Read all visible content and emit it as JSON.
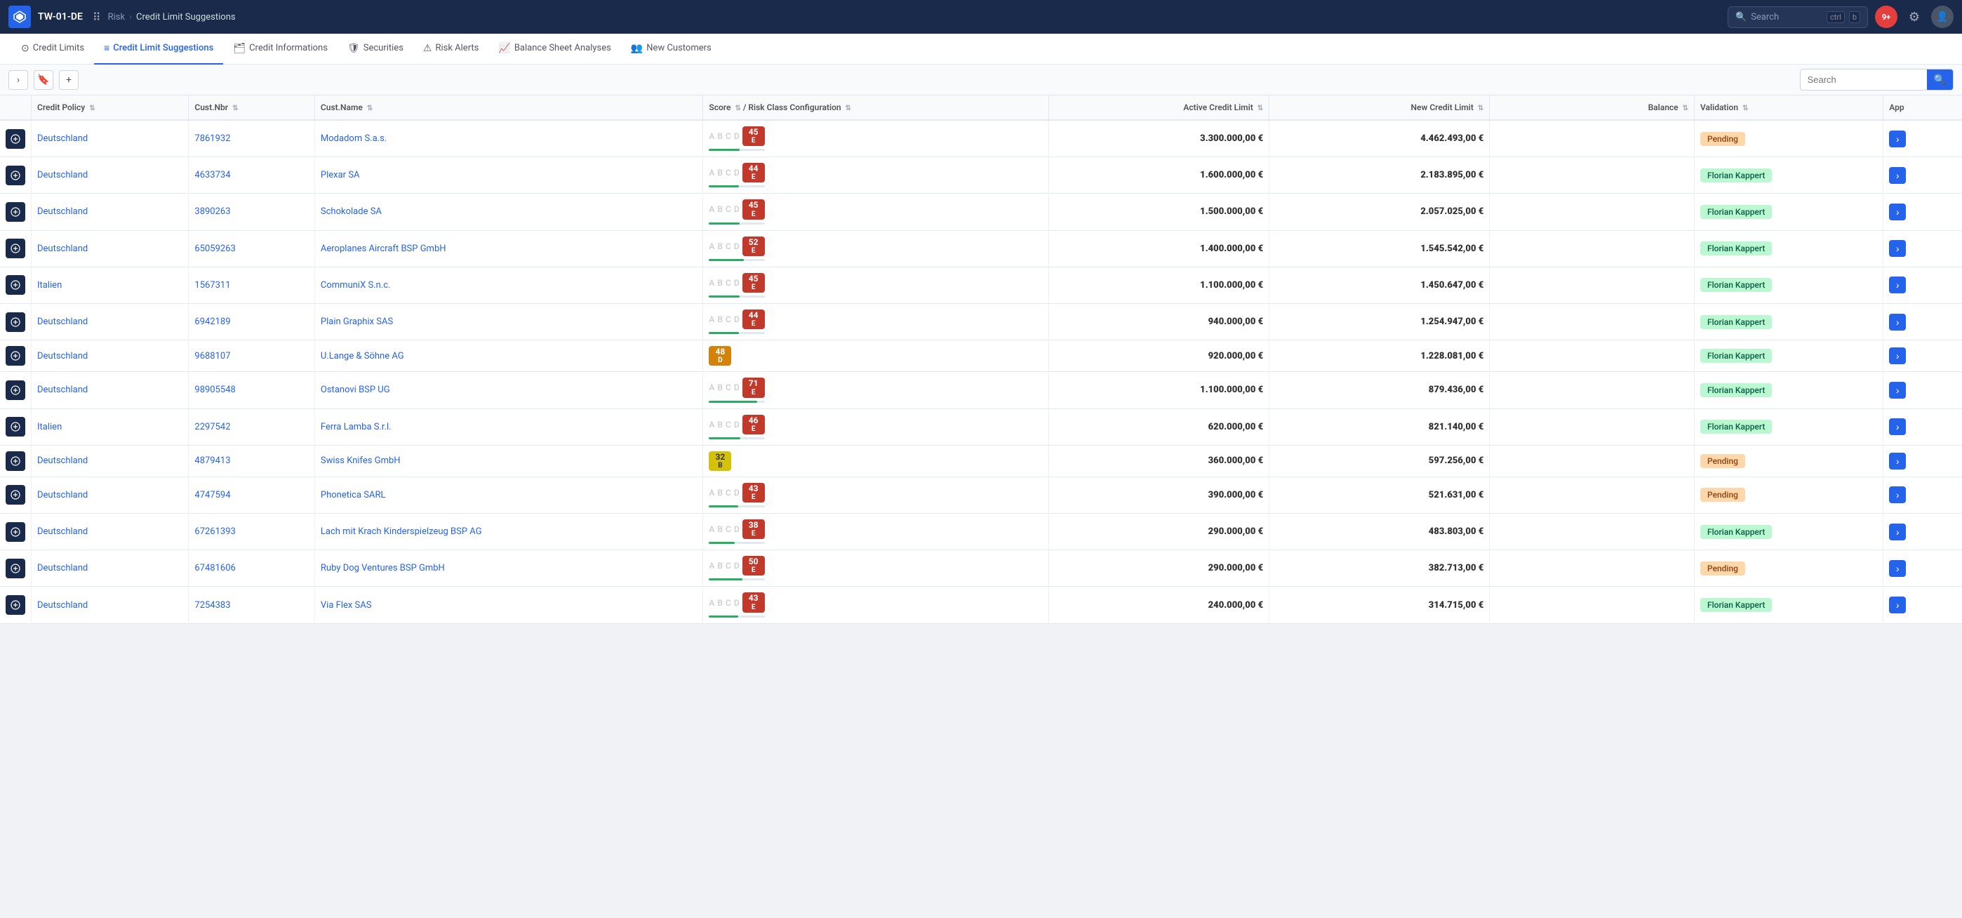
{
  "topbar": {
    "appcode": "TW-01-DE",
    "breadcrumb_root": "Risk",
    "breadcrumb_current": "Credit Limit Suggestions",
    "search_placeholder": "Search",
    "search_shortcut": "ctrl b",
    "notif_count": "9+"
  },
  "nav": {
    "items": [
      {
        "id": "credit-limits",
        "label": "Credit Limits",
        "icon": "⊙",
        "active": false
      },
      {
        "id": "credit-limit-suggestions",
        "label": "Credit Limit Suggestions",
        "icon": "≡",
        "active": true
      },
      {
        "id": "credit-informations",
        "label": "Credit Informations",
        "icon": "🗂",
        "active": false
      },
      {
        "id": "securities",
        "label": "Securities",
        "icon": "🛡",
        "active": false
      },
      {
        "id": "risk-alerts",
        "label": "Risk Alerts",
        "icon": "⚠",
        "active": false
      },
      {
        "id": "balance-sheet-analyses",
        "label": "Balance Sheet Analyses",
        "icon": "📈",
        "active": false
      },
      {
        "id": "new-customers",
        "label": "New Customers",
        "icon": "👥",
        "active": false
      }
    ]
  },
  "toolbar": {
    "search_placeholder": "Search"
  },
  "table": {
    "columns": [
      {
        "id": "icon",
        "label": ""
      },
      {
        "id": "credit-policy",
        "label": "Credit Policy"
      },
      {
        "id": "cust-nbr",
        "label": "Cust.Nbr"
      },
      {
        "id": "cust-name",
        "label": "Cust.Name"
      },
      {
        "id": "score",
        "label": "Score / Risk Class Configuration"
      },
      {
        "id": "active-credit-limit",
        "label": "Active Credit Limit"
      },
      {
        "id": "new-credit-limit",
        "label": "New Credit Limit"
      },
      {
        "id": "balance",
        "label": "Balance"
      },
      {
        "id": "validation",
        "label": "Validation"
      },
      {
        "id": "app",
        "label": "App"
      }
    ],
    "rows": [
      {
        "policy": "Deutschland",
        "cust_nbr": "7861932",
        "cust_name": "Modadom S.a.s.",
        "score": 45,
        "score_letter": "E",
        "badge_class": "badge-e",
        "has_abcd": true,
        "active_credit_limit": "3.300.000,00 €",
        "new_credit_limit": "4.462.493,00 €",
        "balance": "",
        "validation": "Pending",
        "validation_class": "status-pending"
      },
      {
        "policy": "Deutschland",
        "cust_nbr": "4633734",
        "cust_name": "Plexar SA",
        "score": 44,
        "score_letter": "E",
        "badge_class": "badge-e",
        "has_abcd": true,
        "active_credit_limit": "1.600.000,00 €",
        "new_credit_limit": "2.183.895,00 €",
        "balance": "",
        "validation": "Florian Kappert",
        "validation_class": "status-florian"
      },
      {
        "policy": "Deutschland",
        "cust_nbr": "3890263",
        "cust_name": "Schokolade SA",
        "score": 45,
        "score_letter": "E",
        "badge_class": "badge-e",
        "has_abcd": true,
        "active_credit_limit": "1.500.000,00 €",
        "new_credit_limit": "2.057.025,00 €",
        "balance": "",
        "validation": "Florian Kappert",
        "validation_class": "status-florian"
      },
      {
        "policy": "Deutschland",
        "cust_nbr": "65059263",
        "cust_name": "Aeroplanes Aircraft BSP GmbH",
        "score": 52,
        "score_letter": "E",
        "badge_class": "badge-e",
        "has_abcd": true,
        "active_credit_limit": "1.400.000,00 €",
        "new_credit_limit": "1.545.542,00 €",
        "balance": "",
        "validation": "Florian Kappert",
        "validation_class": "status-florian"
      },
      {
        "policy": "Italien",
        "cust_nbr": "1567311",
        "cust_name": "CommuniX S.n.c.",
        "score": 45,
        "score_letter": "E",
        "badge_class": "badge-e",
        "has_abcd": true,
        "active_credit_limit": "1.100.000,00 €",
        "new_credit_limit": "1.450.647,00 €",
        "balance": "",
        "validation": "Florian Kappert",
        "validation_class": "status-florian"
      },
      {
        "policy": "Deutschland",
        "cust_nbr": "6942189",
        "cust_name": "Plain Graphix SAS",
        "score": 44,
        "score_letter": "E",
        "badge_class": "badge-e",
        "has_abcd": true,
        "active_credit_limit": "940.000,00 €",
        "new_credit_limit": "1.254.947,00 €",
        "balance": "",
        "validation": "Florian Kappert",
        "validation_class": "status-florian"
      },
      {
        "policy": "Deutschland",
        "cust_nbr": "9688107",
        "cust_name": "U.Lange & Söhne AG",
        "score": 48,
        "score_letter": "D",
        "badge_class": "badge-d",
        "has_abcd": false,
        "active_credit_limit": "920.000,00 €",
        "new_credit_limit": "1.228.081,00 €",
        "balance": "",
        "validation": "Florian Kappert",
        "validation_class": "status-florian"
      },
      {
        "policy": "Deutschland",
        "cust_nbr": "98905548",
        "cust_name": "Ostanovi BSP UG",
        "score": 71,
        "score_letter": "E",
        "badge_class": "badge-e",
        "has_abcd": true,
        "active_credit_limit": "1.100.000,00 €",
        "new_credit_limit": "879.436,00 €",
        "balance": "",
        "validation": "Florian Kappert",
        "validation_class": "status-florian"
      },
      {
        "policy": "Italien",
        "cust_nbr": "2297542",
        "cust_name": "Ferra Lamba S.r.l.",
        "score": 46,
        "score_letter": "E",
        "badge_class": "badge-e",
        "has_abcd": true,
        "active_credit_limit": "620.000,00 €",
        "new_credit_limit": "821.140,00 €",
        "balance": "",
        "validation": "Florian Kappert",
        "validation_class": "status-florian"
      },
      {
        "policy": "Deutschland",
        "cust_nbr": "4879413",
        "cust_name": "Swiss Knifes GmbH",
        "score": 32,
        "score_letter": "B",
        "badge_class": "badge-b",
        "has_abcd": false,
        "active_credit_limit": "360.000,00 €",
        "new_credit_limit": "597.256,00 €",
        "balance": "",
        "validation": "Pending",
        "validation_class": "status-pending"
      },
      {
        "policy": "Deutschland",
        "cust_nbr": "4747594",
        "cust_name": "Phonetica SARL",
        "score": 43,
        "score_letter": "E",
        "badge_class": "badge-e",
        "has_abcd": true,
        "active_credit_limit": "390.000,00 €",
        "new_credit_limit": "521.631,00 €",
        "balance": "",
        "validation": "Pending",
        "validation_class": "status-pending"
      },
      {
        "policy": "Deutschland",
        "cust_nbr": "67261393",
        "cust_name": "Lach mit Krach Kinderspielzeug BSP AG",
        "score": 38,
        "score_letter": "E",
        "badge_class": "badge-e",
        "has_abcd": true,
        "active_credit_limit": "290.000,00 €",
        "new_credit_limit": "483.803,00 €",
        "balance": "",
        "validation": "Florian Kappert",
        "validation_class": "status-florian"
      },
      {
        "policy": "Deutschland",
        "cust_nbr": "67481606",
        "cust_name": "Ruby Dog Ventures BSP GmbH",
        "score": 50,
        "score_letter": "E",
        "badge_class": "badge-e",
        "has_abcd": true,
        "active_credit_limit": "290.000,00 €",
        "new_credit_limit": "382.713,00 €",
        "balance": "",
        "validation": "Pending",
        "validation_class": "status-pending"
      },
      {
        "policy": "Deutschland",
        "cust_nbr": "7254383",
        "cust_name": "Via Flex SAS",
        "score": 43,
        "score_letter": "E",
        "badge_class": "badge-e",
        "has_abcd": true,
        "active_credit_limit": "240.000,00 €",
        "new_credit_limit": "314.715,00 €",
        "balance": "",
        "validation": "Florian Kappert",
        "validation_class": "status-florian"
      }
    ]
  }
}
